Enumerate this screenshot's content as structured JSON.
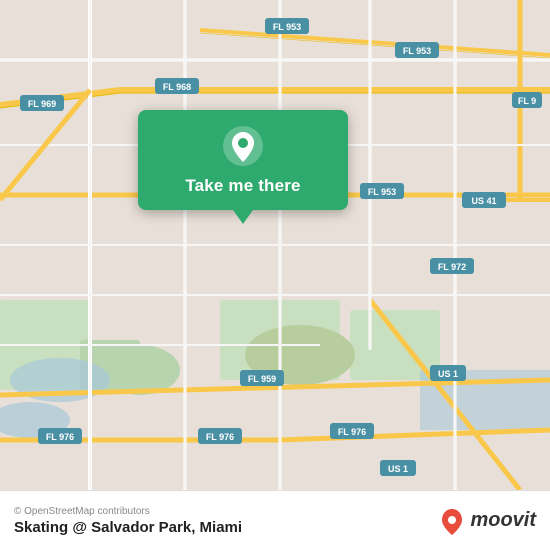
{
  "map": {
    "attribution": "© OpenStreetMap contributors",
    "location_title": "Skating @ Salvador Park, Miami",
    "background_color": "#e8e0d8"
  },
  "callout": {
    "label": "Take me there",
    "icon": "location-pin-icon"
  },
  "roads": {
    "highway_color": "#f9c84a",
    "road_color": "#ffffff",
    "road_stroke": "#cccccc",
    "labels": [
      "FL 953",
      "FL 959",
      "FL 968",
      "FL 969",
      "FL 953",
      "FL 976",
      "FL 976",
      "FL 976",
      "FL 959",
      "FL 972",
      "US 41",
      "US 1",
      "FL 9",
      "FL 953"
    ]
  },
  "moovit": {
    "text": "moovit",
    "icon_color_top": "#e84c3d",
    "icon_color_bottom": "#c0392b"
  }
}
